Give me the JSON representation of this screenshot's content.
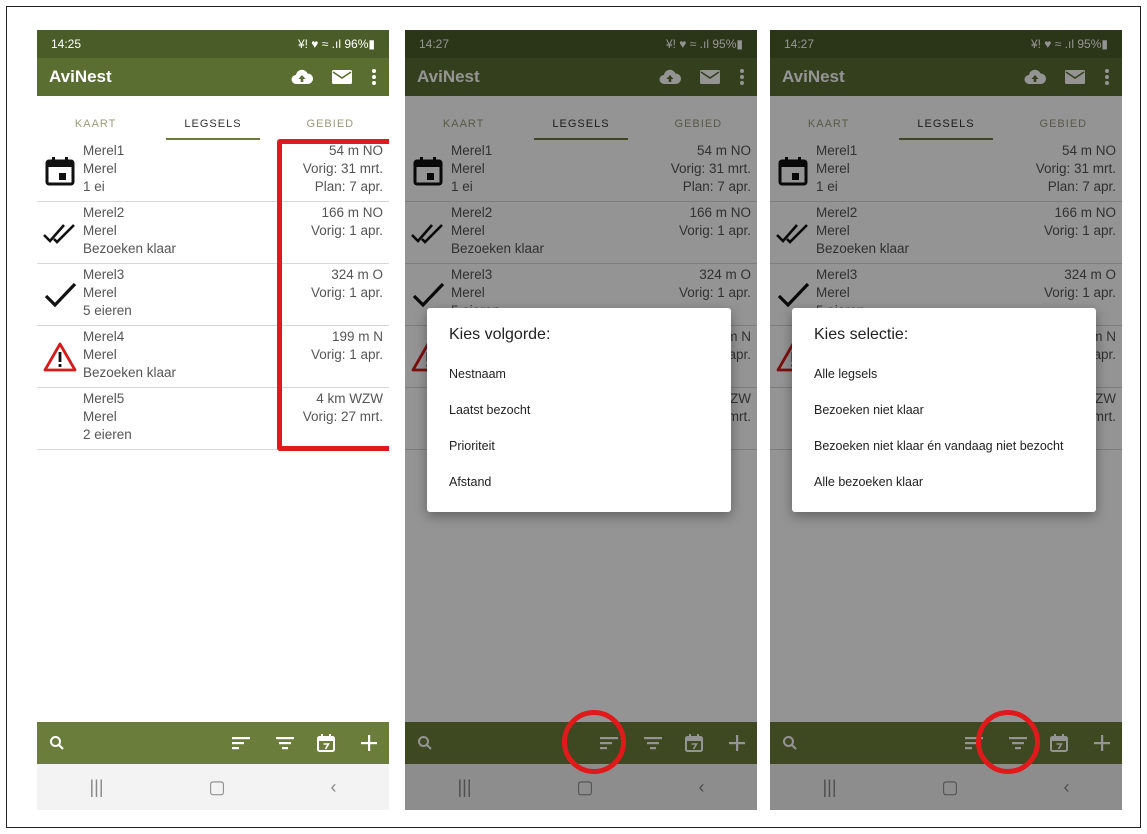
{
  "colors": {
    "appbar": "#5a6e32",
    "statusbar": "#4a5c28",
    "bottombar": "#6b7d3a",
    "accent": "#e01a1a"
  },
  "app_title": "AviNest",
  "tabs": [
    "KAART",
    "LEGSELS",
    "GEBIED"
  ],
  "screens": [
    {
      "time": "14:25",
      "battery": "96%",
      "status_icons": "¥! ♥ ≈ .ıl"
    },
    {
      "time": "14:27",
      "battery": "95%",
      "status_icons": "¥! ♥ ≈ .ıl"
    },
    {
      "time": "14:27",
      "battery": "95%",
      "status_icons": "¥! ♥ ≈ .ıl"
    }
  ],
  "nests": [
    {
      "name": "Merel1",
      "species": "Merel",
      "detail": "1 ei",
      "distance": "54 m NO",
      "last": "Vorig: 31 mrt.",
      "plan": "Plan: 7 apr.",
      "icon": "calendar-icon"
    },
    {
      "name": "Merel2",
      "species": "Merel",
      "detail": "Bezoeken klaar",
      "distance": "166 m NO",
      "last": "Vorig: 1 apr.",
      "plan": "",
      "icon": "double-check-icon"
    },
    {
      "name": "Merel3",
      "species": "Merel",
      "detail": "5 eieren",
      "distance": "324 m O",
      "last": "Vorig: 1 apr.",
      "plan": "",
      "icon": "check-icon"
    },
    {
      "name": "Merel4",
      "species": "Merel",
      "detail": "Bezoeken klaar",
      "distance": "199 m N",
      "last": "Vorig: 1 apr.",
      "plan": "",
      "icon": "warning-icon"
    },
    {
      "name": "Merel5",
      "species": "Merel",
      "detail": "2 eieren",
      "distance": "4 km WZW",
      "last": "Vorig: 27 mrt.",
      "plan": "",
      "icon": ""
    }
  ],
  "sort_dialog": {
    "title": "Kies volgorde:",
    "options": [
      "Nestnaam",
      "Laatst bezocht",
      "Prioriteit",
      "Afstand"
    ]
  },
  "filter_dialog": {
    "title": "Kies selectie:",
    "options": [
      "Alle legsels",
      "Bezoeken niet klaar",
      "Bezoeken niet klaar én vandaag niet bezocht",
      "Alle bezoeken klaar"
    ]
  }
}
